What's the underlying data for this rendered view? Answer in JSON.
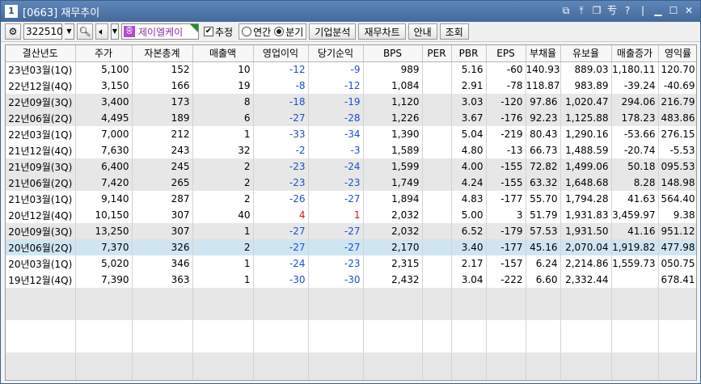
{
  "window": {
    "number": "1",
    "title": "[0663] 재무추이"
  },
  "toolbar": {
    "stock_code": "322510",
    "stock_name_badge": "중",
    "stock_name": "제이엘케이",
    "estimate_label": "추정",
    "estimate_checked": true,
    "annual_label": "연간",
    "quarter_label": "분기",
    "selected_period": "quarter",
    "btn_company": "기업분석",
    "btn_fin_chart": "재무차트",
    "btn_guide": "안내",
    "btn_query": "조회"
  },
  "table": {
    "headers": [
      "결산년도",
      "주가",
      "자본총계",
      "매출액",
      "영업이익",
      "당기순익",
      "BPS",
      "PER",
      "PBR",
      "EPS",
      "부채율",
      "유보율",
      "매출증가",
      "영익률"
    ],
    "rows": [
      [
        "23년03월(1Q)",
        "5,100",
        "152",
        "10",
        "-12",
        "-9",
        "989",
        "",
        "5.16",
        "-60",
        "140.93",
        "889.03",
        "1,180.11",
        "120.70"
      ],
      [
        "22년12월(4Q)",
        "3,150",
        "166",
        "19",
        "-8",
        "-12",
        "1,084",
        "",
        "2.91",
        "-78",
        "118.87",
        "983.89",
        "-39.24",
        "-40.69"
      ],
      [
        "22년09월(3Q)",
        "3,400",
        "173",
        "8",
        "-18",
        "-19",
        "1,120",
        "",
        "3.03",
        "-120",
        "97.86",
        "1,020.47",
        "294.06",
        "216.79"
      ],
      [
        "22년06월(2Q)",
        "4,495",
        "189",
        "6",
        "-27",
        "-28",
        "1,226",
        "",
        "3.67",
        "-176",
        "92.23",
        "1,125.88",
        "178.23",
        "483.86"
      ],
      [
        "22년03월(1Q)",
        "7,000",
        "212",
        "1",
        "-33",
        "-34",
        "1,390",
        "",
        "5.04",
        "-219",
        "80.43",
        "1,290.16",
        "-53.66",
        "276.15"
      ],
      [
        "21년12월(4Q)",
        "7,630",
        "243",
        "32",
        "-2",
        "-3",
        "1,589",
        "",
        "4.80",
        "-13",
        "66.73",
        "1,488.59",
        "-20.74",
        "-5.53"
      ],
      [
        "21년09월(3Q)",
        "6,400",
        "245",
        "2",
        "-23",
        "-24",
        "1,599",
        "",
        "4.00",
        "-155",
        "72.82",
        "1,499.06",
        "50.18",
        "095.53"
      ],
      [
        "21년06월(2Q)",
        "7,420",
        "265",
        "2",
        "-23",
        "-23",
        "1,749",
        "",
        "4.24",
        "-155",
        "63.32",
        "1,648.68",
        "8.28",
        "148.98"
      ],
      [
        "21년03월(1Q)",
        "9,140",
        "287",
        "2",
        "-26",
        "-27",
        "1,894",
        "",
        "4.83",
        "-177",
        "55.70",
        "1,794.28",
        "41.63",
        "564.40"
      ],
      [
        "20년12월(4Q)",
        "10,150",
        "307",
        "40",
        "4",
        "1",
        "2,032",
        "",
        "5.00",
        "3",
        "51.79",
        "1,931.83",
        "3,459.97",
        "9.38"
      ],
      [
        "20년09월(3Q)",
        "13,250",
        "307",
        "1",
        "-27",
        "-27",
        "2,032",
        "",
        "6.52",
        "-179",
        "57.53",
        "1,931.50",
        "41.16",
        "951.12"
      ],
      [
        "20년06월(2Q)",
        "7,370",
        "326",
        "2",
        "-27",
        "-27",
        "2,170",
        "",
        "3.40",
        "-177",
        "45.16",
        "2,070.04",
        "1,919.82",
        "477.98"
      ],
      [
        "20년03월(1Q)",
        "5,020",
        "346",
        "1",
        "-24",
        "-23",
        "2,315",
        "",
        "2.17",
        "-157",
        "6.24",
        "2,214.86",
        "1,559.73",
        "050.75"
      ],
      [
        "19년12월(4Q)",
        "7,390",
        "363",
        "1",
        "-30",
        "-30",
        "2,432",
        "",
        "3.04",
        "-222",
        "6.60",
        "2,332.44",
        "",
        "678.41"
      ]
    ],
    "row_shading": [
      "white",
      "white",
      "gray",
      "gray",
      "white",
      "white",
      "gray",
      "gray",
      "white",
      "white",
      "gray",
      "selected",
      "white",
      "white"
    ],
    "empty_row_shading": [
      "gray",
      "gray",
      "white",
      "white",
      "gray",
      "gray"
    ],
    "colors": {
      "negative": "#1a4fd1",
      "positive_profit": "#e01010",
      "selected_row": "#cfe6f2",
      "gray_row": "#e7e7e7",
      "title_bar": "#4f76a8"
    }
  }
}
